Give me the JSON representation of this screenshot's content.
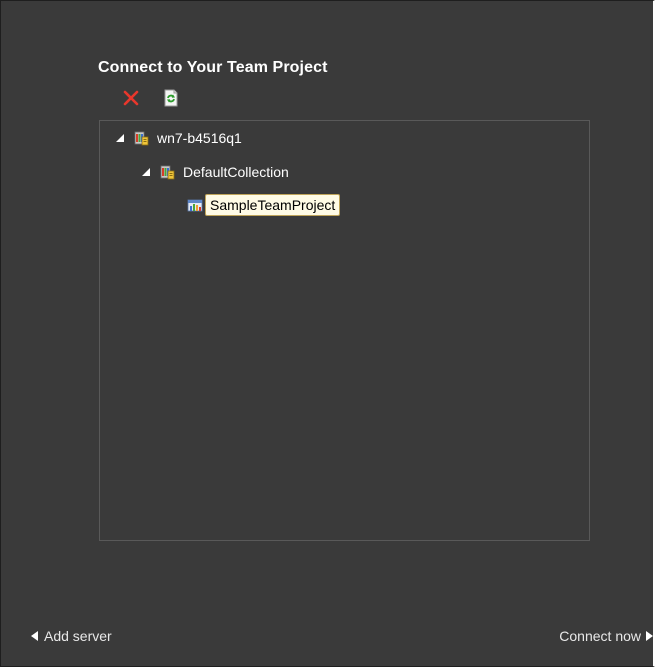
{
  "dialog": {
    "title": "Connect to Your Team Project"
  },
  "toolbar": {
    "remove_icon": "red-x-icon",
    "refresh_icon": "refresh-icon"
  },
  "tree": {
    "nodes": [
      {
        "label": "wn7-b4516q1",
        "icon": "server-icon",
        "expanded": true
      },
      {
        "label": "DefaultCollection",
        "icon": "collection-icon",
        "expanded": true
      },
      {
        "label": "SampleTeamProject",
        "icon": "team-project-icon",
        "selected": true
      }
    ]
  },
  "footer": {
    "add_server_label": "Add server",
    "connect_now_label": "Connect now"
  },
  "colors": {
    "background": "#3a3a3a",
    "text": "#ffffff",
    "selection_bg": "#fffbe6",
    "remove_icon": "#e8372c"
  }
}
